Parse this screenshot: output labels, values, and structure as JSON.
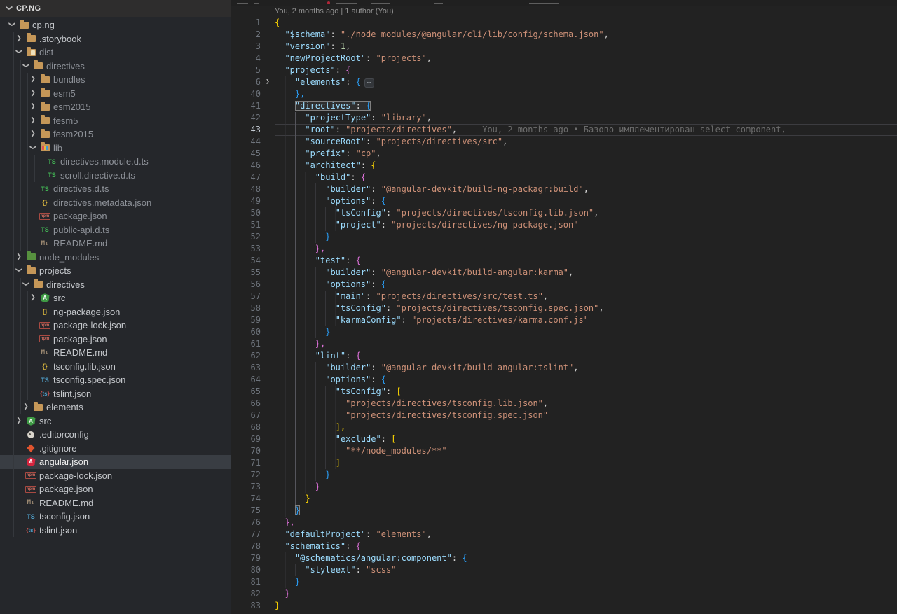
{
  "colors": {
    "editor_bg": "#222222",
    "sidebar_bg": "#25272b",
    "selected_row_bg": "#393d43",
    "folder_icon": "#c59758",
    "angular_icon_red": "#d6253f",
    "bracket_level1": "#ffd700",
    "bracket_level2": "#da70d6",
    "bracket_level3": "#2a9df4",
    "json_key": "#9cdcfe",
    "json_string": "#ce9178",
    "json_number": "#b5cea8"
  },
  "explorer": {
    "section_title": "CP.NG",
    "tree": [
      {
        "label": "cp.ng",
        "icon": "folder",
        "depth": 0,
        "chevron": "down"
      },
      {
        "label": ".storybook",
        "icon": "folder",
        "depth": 1,
        "chevron": "right"
      },
      {
        "label": "dist",
        "icon": "folder-dist",
        "depth": 1,
        "chevron": "down",
        "dim": true
      },
      {
        "label": "directives",
        "icon": "folder",
        "depth": 2,
        "chevron": "down",
        "dim": true
      },
      {
        "label": "bundles",
        "icon": "folder",
        "depth": 3,
        "chevron": "right",
        "dim": true
      },
      {
        "label": "esm5",
        "icon": "folder",
        "depth": 3,
        "chevron": "right",
        "dim": true
      },
      {
        "label": "esm2015",
        "icon": "folder",
        "depth": 3,
        "chevron": "right",
        "dim": true
      },
      {
        "label": "fesm5",
        "icon": "folder",
        "depth": 3,
        "chevron": "right",
        "dim": true
      },
      {
        "label": "fesm2015",
        "icon": "folder",
        "depth": 3,
        "chevron": "right",
        "dim": true
      },
      {
        "label": "lib",
        "icon": "folder-lib",
        "depth": 3,
        "chevron": "down",
        "dim": true
      },
      {
        "label": "directives.module.d.ts",
        "icon": "ts-green",
        "depth": 4,
        "dim": true
      },
      {
        "label": "scroll.directive.d.ts",
        "icon": "ts-green",
        "depth": 4,
        "dim": true
      },
      {
        "label": "directives.d.ts",
        "icon": "ts-green",
        "depth": 3,
        "dim": true
      },
      {
        "label": "directives.metadata.json",
        "icon": "braces",
        "depth": 3,
        "dim": true
      },
      {
        "label": "package.json",
        "icon": "npm",
        "depth": 3,
        "dim": true
      },
      {
        "label": "public-api.d.ts",
        "icon": "ts-green",
        "depth": 3,
        "dim": true
      },
      {
        "label": "README.md",
        "icon": "md",
        "depth": 3,
        "dim": true
      },
      {
        "label": "node_modules",
        "icon": "folder-npm",
        "depth": 1,
        "chevron": "right",
        "dim": true
      },
      {
        "label": "projects",
        "icon": "folder",
        "depth": 1,
        "chevron": "down"
      },
      {
        "label": "directives",
        "icon": "folder",
        "depth": 2,
        "chevron": "down"
      },
      {
        "label": "src",
        "icon": "folder-src",
        "depth": 3,
        "chevron": "right"
      },
      {
        "label": "ng-package.json",
        "icon": "braces",
        "depth": 3
      },
      {
        "label": "package-lock.json",
        "icon": "npm",
        "depth": 3
      },
      {
        "label": "package.json",
        "icon": "npm",
        "depth": 3
      },
      {
        "label": "README.md",
        "icon": "md",
        "depth": 3
      },
      {
        "label": "tsconfig.lib.json",
        "icon": "braces",
        "depth": 3
      },
      {
        "label": "tsconfig.spec.json",
        "icon": "ts-blue",
        "depth": 3
      },
      {
        "label": "tslint.json",
        "icon": "tslint",
        "depth": 3
      },
      {
        "label": "elements",
        "icon": "folder",
        "depth": 2,
        "chevron": "right"
      },
      {
        "label": "src",
        "icon": "folder-src",
        "depth": 1,
        "chevron": "right"
      },
      {
        "label": ".editorconfig",
        "icon": "editorconfig",
        "depth": 1
      },
      {
        "label": ".gitignore",
        "icon": "git",
        "depth": 1
      },
      {
        "label": "angular.json",
        "icon": "angular",
        "depth": 1,
        "selected": true
      },
      {
        "label": "package-lock.json",
        "icon": "npm",
        "depth": 1
      },
      {
        "label": "package.json",
        "icon": "npm",
        "depth": 1
      },
      {
        "label": "README.md",
        "icon": "md",
        "depth": 1
      },
      {
        "label": "tsconfig.json",
        "icon": "ts-blue",
        "depth": 1
      },
      {
        "label": "tslint.json",
        "icon": "tslint",
        "depth": 1
      }
    ]
  },
  "editor": {
    "codelens": "You, 2 months ago | 1 author (You)",
    "blame_line_43": "You, 2 months ago • Базово имплементирован select component,",
    "fold_badge": "⋯",
    "active_guide": {
      "from": 42,
      "to": 74,
      "col": 4
    },
    "lines": [
      {
        "n": 1,
        "ind": 0,
        "t": [
          [
            "b1",
            "{"
          ]
        ]
      },
      {
        "n": 2,
        "ind": 2,
        "t": [
          [
            "k",
            "\"$schema\""
          ],
          [
            "p",
            ": "
          ],
          [
            "s",
            "\"./node_modules/@angular/cli/lib/config/schema.json\""
          ],
          [
            "p",
            ","
          ]
        ]
      },
      {
        "n": 3,
        "ind": 2,
        "t": [
          [
            "k",
            "\"version\""
          ],
          [
            "p",
            ": "
          ],
          [
            "num",
            "1"
          ],
          [
            "p",
            ","
          ]
        ]
      },
      {
        "n": 4,
        "ind": 2,
        "t": [
          [
            "k",
            "\"newProjectRoot\""
          ],
          [
            "p",
            ": "
          ],
          [
            "s",
            "\"projects\""
          ],
          [
            "p",
            ","
          ]
        ]
      },
      {
        "n": 5,
        "ind": 2,
        "t": [
          [
            "k",
            "\"projects\""
          ],
          [
            "p",
            ": "
          ],
          [
            "b2",
            "{"
          ]
        ]
      },
      {
        "n": 6,
        "ind": 4,
        "fold": true,
        "t": [
          [
            "k",
            "\"elements\""
          ],
          [
            "p",
            ": "
          ],
          [
            "b3",
            "{"
          ],
          [
            "fb",
            "⋯"
          ]
        ]
      },
      {
        "n": 40,
        "ind": 4,
        "t": [
          [
            "b3",
            "},"
          ]
        ]
      },
      {
        "n": 41,
        "ind": 4,
        "box": true,
        "t": [
          [
            "k",
            "\"directives\""
          ],
          [
            "p",
            ": "
          ],
          [
            "b3",
            "{"
          ]
        ]
      },
      {
        "n": 42,
        "ind": 6,
        "t": [
          [
            "k",
            "\"projectType\""
          ],
          [
            "p",
            ": "
          ],
          [
            "s",
            "\"library\""
          ],
          [
            "p",
            ","
          ]
        ]
      },
      {
        "n": 43,
        "ind": 6,
        "cur": true,
        "t": [
          [
            "k",
            "\"root\""
          ],
          [
            "p",
            ": "
          ],
          [
            "s",
            "\"projects/directives\""
          ],
          [
            "p",
            ","
          ],
          [
            "bl",
            "     You, 2 months ago • Базово имплементирован select component,"
          ]
        ]
      },
      {
        "n": 44,
        "ind": 6,
        "t": [
          [
            "k",
            "\"sourceRoot\""
          ],
          [
            "p",
            ": "
          ],
          [
            "s",
            "\"projects/directives/src\""
          ],
          [
            "p",
            ","
          ]
        ]
      },
      {
        "n": 45,
        "ind": 6,
        "t": [
          [
            "k",
            "\"prefix\""
          ],
          [
            "p",
            ": "
          ],
          [
            "s",
            "\"cp\""
          ],
          [
            "p",
            ","
          ]
        ]
      },
      {
        "n": 46,
        "ind": 6,
        "t": [
          [
            "k",
            "\"architect\""
          ],
          [
            "p",
            ": "
          ],
          [
            "b1",
            "{"
          ]
        ]
      },
      {
        "n": 47,
        "ind": 8,
        "t": [
          [
            "k",
            "\"build\""
          ],
          [
            "p",
            ": "
          ],
          [
            "b2",
            "{"
          ]
        ]
      },
      {
        "n": 48,
        "ind": 10,
        "t": [
          [
            "k",
            "\"builder\""
          ],
          [
            "p",
            ": "
          ],
          [
            "s",
            "\"@angular-devkit/build-ng-packagr:build\""
          ],
          [
            "p",
            ","
          ]
        ]
      },
      {
        "n": 49,
        "ind": 10,
        "t": [
          [
            "k",
            "\"options\""
          ],
          [
            "p",
            ": "
          ],
          [
            "b3",
            "{"
          ]
        ]
      },
      {
        "n": 50,
        "ind": 12,
        "t": [
          [
            "k",
            "\"tsConfig\""
          ],
          [
            "p",
            ": "
          ],
          [
            "s",
            "\"projects/directives/tsconfig.lib.json\""
          ],
          [
            "p",
            ","
          ]
        ]
      },
      {
        "n": 51,
        "ind": 12,
        "t": [
          [
            "k",
            "\"project\""
          ],
          [
            "p",
            ": "
          ],
          [
            "s",
            "\"projects/directives/ng-package.json\""
          ]
        ]
      },
      {
        "n": 52,
        "ind": 10,
        "t": [
          [
            "b3",
            "}"
          ]
        ]
      },
      {
        "n": 53,
        "ind": 8,
        "t": [
          [
            "b2",
            "},"
          ]
        ]
      },
      {
        "n": 54,
        "ind": 8,
        "t": [
          [
            "k",
            "\"test\""
          ],
          [
            "p",
            ": "
          ],
          [
            "b2",
            "{"
          ]
        ]
      },
      {
        "n": 55,
        "ind": 10,
        "t": [
          [
            "k",
            "\"builder\""
          ],
          [
            "p",
            ": "
          ],
          [
            "s",
            "\"@angular-devkit/build-angular:karma\""
          ],
          [
            "p",
            ","
          ]
        ]
      },
      {
        "n": 56,
        "ind": 10,
        "t": [
          [
            "k",
            "\"options\""
          ],
          [
            "p",
            ": "
          ],
          [
            "b3",
            "{"
          ]
        ]
      },
      {
        "n": 57,
        "ind": 12,
        "t": [
          [
            "k",
            "\"main\""
          ],
          [
            "p",
            ": "
          ],
          [
            "s",
            "\"projects/directives/src/test.ts\""
          ],
          [
            "p",
            ","
          ]
        ]
      },
      {
        "n": 58,
        "ind": 12,
        "t": [
          [
            "k",
            "\"tsConfig\""
          ],
          [
            "p",
            ": "
          ],
          [
            "s",
            "\"projects/directives/tsconfig.spec.json\""
          ],
          [
            "p",
            ","
          ]
        ]
      },
      {
        "n": 59,
        "ind": 12,
        "t": [
          [
            "k",
            "\"karmaConfig\""
          ],
          [
            "p",
            ": "
          ],
          [
            "s",
            "\"projects/directives/karma.conf.js\""
          ]
        ]
      },
      {
        "n": 60,
        "ind": 10,
        "t": [
          [
            "b3",
            "}"
          ]
        ]
      },
      {
        "n": 61,
        "ind": 8,
        "t": [
          [
            "b2",
            "},"
          ]
        ]
      },
      {
        "n": 62,
        "ind": 8,
        "t": [
          [
            "k",
            "\"lint\""
          ],
          [
            "p",
            ": "
          ],
          [
            "b2",
            "{"
          ]
        ]
      },
      {
        "n": 63,
        "ind": 10,
        "t": [
          [
            "k",
            "\"builder\""
          ],
          [
            "p",
            ": "
          ],
          [
            "s",
            "\"@angular-devkit/build-angular:tslint\""
          ],
          [
            "p",
            ","
          ]
        ]
      },
      {
        "n": 64,
        "ind": 10,
        "t": [
          [
            "k",
            "\"options\""
          ],
          [
            "p",
            ": "
          ],
          [
            "b3",
            "{"
          ]
        ]
      },
      {
        "n": 65,
        "ind": 12,
        "t": [
          [
            "k",
            "\"tsConfig\""
          ],
          [
            "p",
            ": "
          ],
          [
            "b1",
            "["
          ]
        ]
      },
      {
        "n": 66,
        "ind": 14,
        "t": [
          [
            "s",
            "\"projects/directives/tsconfig.lib.json\""
          ],
          [
            "p",
            ","
          ]
        ]
      },
      {
        "n": 67,
        "ind": 14,
        "t": [
          [
            "s",
            "\"projects/directives/tsconfig.spec.json\""
          ]
        ]
      },
      {
        "n": 68,
        "ind": 12,
        "t": [
          [
            "b1",
            "],"
          ]
        ]
      },
      {
        "n": 69,
        "ind": 12,
        "t": [
          [
            "k",
            "\"exclude\""
          ],
          [
            "p",
            ": "
          ],
          [
            "b1",
            "["
          ]
        ]
      },
      {
        "n": 70,
        "ind": 14,
        "t": [
          [
            "s",
            "\"**/node_modules/**\""
          ]
        ]
      },
      {
        "n": 71,
        "ind": 12,
        "t": [
          [
            "b1",
            "]"
          ]
        ]
      },
      {
        "n": 72,
        "ind": 10,
        "t": [
          [
            "b3",
            "}"
          ]
        ]
      },
      {
        "n": 73,
        "ind": 8,
        "t": [
          [
            "b2",
            "}"
          ]
        ]
      },
      {
        "n": 74,
        "ind": 6,
        "t": [
          [
            "b1",
            "}"
          ]
        ]
      },
      {
        "n": 75,
        "ind": 4,
        "box": true,
        "t": [
          [
            "b3",
            "}"
          ]
        ]
      },
      {
        "n": 76,
        "ind": 2,
        "t": [
          [
            "b2",
            "},"
          ]
        ]
      },
      {
        "n": 77,
        "ind": 2,
        "t": [
          [
            "k",
            "\"defaultProject\""
          ],
          [
            "p",
            ": "
          ],
          [
            "s",
            "\"elements\""
          ],
          [
            "p",
            ","
          ]
        ]
      },
      {
        "n": 78,
        "ind": 2,
        "t": [
          [
            "k",
            "\"schematics\""
          ],
          [
            "p",
            ": "
          ],
          [
            "b2",
            "{"
          ]
        ]
      },
      {
        "n": 79,
        "ind": 4,
        "t": [
          [
            "k",
            "\"@schematics/angular:component\""
          ],
          [
            "p",
            ": "
          ],
          [
            "b3",
            "{"
          ]
        ]
      },
      {
        "n": 80,
        "ind": 6,
        "t": [
          [
            "k",
            "\"styleext\""
          ],
          [
            "p",
            ": "
          ],
          [
            "s",
            "\"scss\""
          ]
        ]
      },
      {
        "n": 81,
        "ind": 4,
        "t": [
          [
            "b3",
            "}"
          ]
        ]
      },
      {
        "n": 82,
        "ind": 2,
        "t": [
          [
            "b2",
            "}"
          ]
        ]
      },
      {
        "n": 83,
        "ind": 0,
        "t": [
          [
            "b1",
            "}"
          ]
        ]
      }
    ]
  }
}
